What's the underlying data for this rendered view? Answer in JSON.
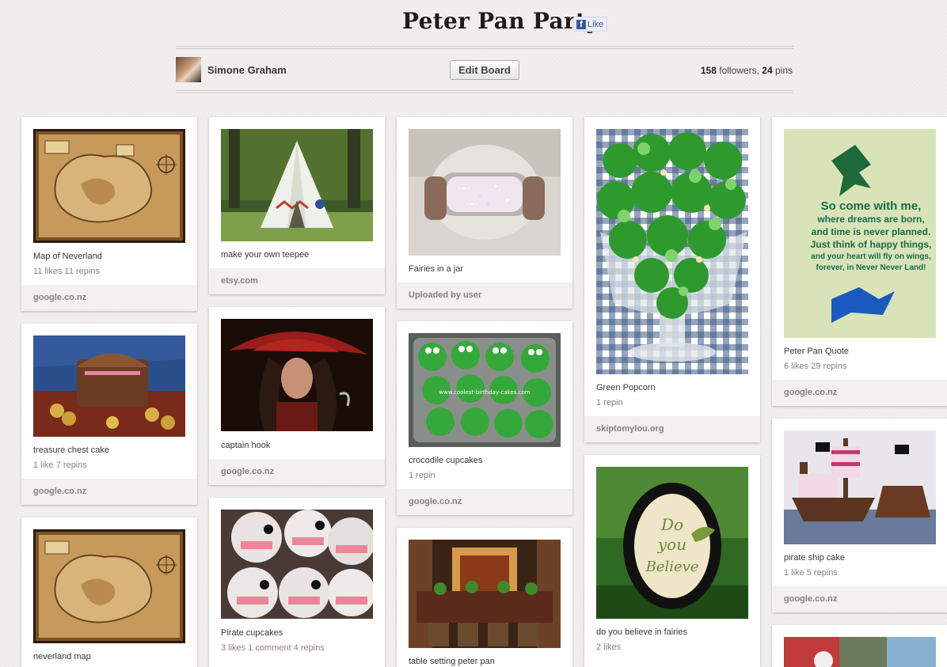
{
  "board": {
    "title": "Peter Pan Party",
    "like_label": "Like",
    "owner_name": "Simone Graham",
    "edit_label": "Edit Board",
    "followers_count": "158",
    "followers_label": "followers,",
    "pins_count": "24",
    "pins_label": "pins"
  },
  "pins": [
    {
      "desc": "Map of Neverland",
      "counts": "11 likes  11 repins",
      "source": "google.co.nz",
      "image": "treasure-map"
    },
    {
      "desc": "treasure chest cake",
      "counts": "1 like  7 repins",
      "source": "google.co.nz",
      "image": "chest-cake"
    },
    {
      "desc": "neverland map",
      "counts": "",
      "source": "",
      "image": "treasure-map"
    },
    {
      "desc": "make your own teepee",
      "counts": "",
      "source": "etsy.com",
      "image": "teepee"
    },
    {
      "desc": "captain hook",
      "counts": "",
      "source": "google.co.nz",
      "image": "captain-hook"
    },
    {
      "desc": "Pirate cupcakes",
      "counts": "3 likes  1 comment  4 repins",
      "source": "",
      "image": "pirate-cupcakes"
    },
    {
      "desc": "Fairies in a jar",
      "counts": "",
      "source": "Uploaded by user",
      "image": "fairy-jar"
    },
    {
      "desc": "crocodile cupcakes",
      "counts": "1 repin",
      "source": "google.co.nz",
      "image": "croc-cupcakes"
    },
    {
      "desc": "table setting peter pan",
      "counts": "",
      "source": "",
      "image": "table-setting"
    },
    {
      "desc": "Green Popcorn",
      "counts": "1 repin",
      "source": "skiptomylou.org",
      "image": "green-popcorn"
    },
    {
      "desc": "do you believe in fairies",
      "counts": "2 likes",
      "source": "",
      "image": "believe-sign"
    },
    {
      "desc": "Peter Pan Quote",
      "counts": "6 likes  29 repins",
      "source": "google.co.nz",
      "image": "quote-poster"
    },
    {
      "desc": "pirate ship cake",
      "counts": "1 like  5 repins",
      "source": "google.co.nz",
      "image": "ship-cake"
    }
  ],
  "quote_text": [
    "So come with me,",
    "where dreams are born,",
    "and time is never planned.",
    "Just think of happy things,",
    "and your heart will fly on wings,",
    "forever, in Never Never Land!"
  ],
  "sign_text": [
    "Do",
    "you",
    "Believe"
  ],
  "watermark_text": "www.coolest-birthday-cakes.com"
}
